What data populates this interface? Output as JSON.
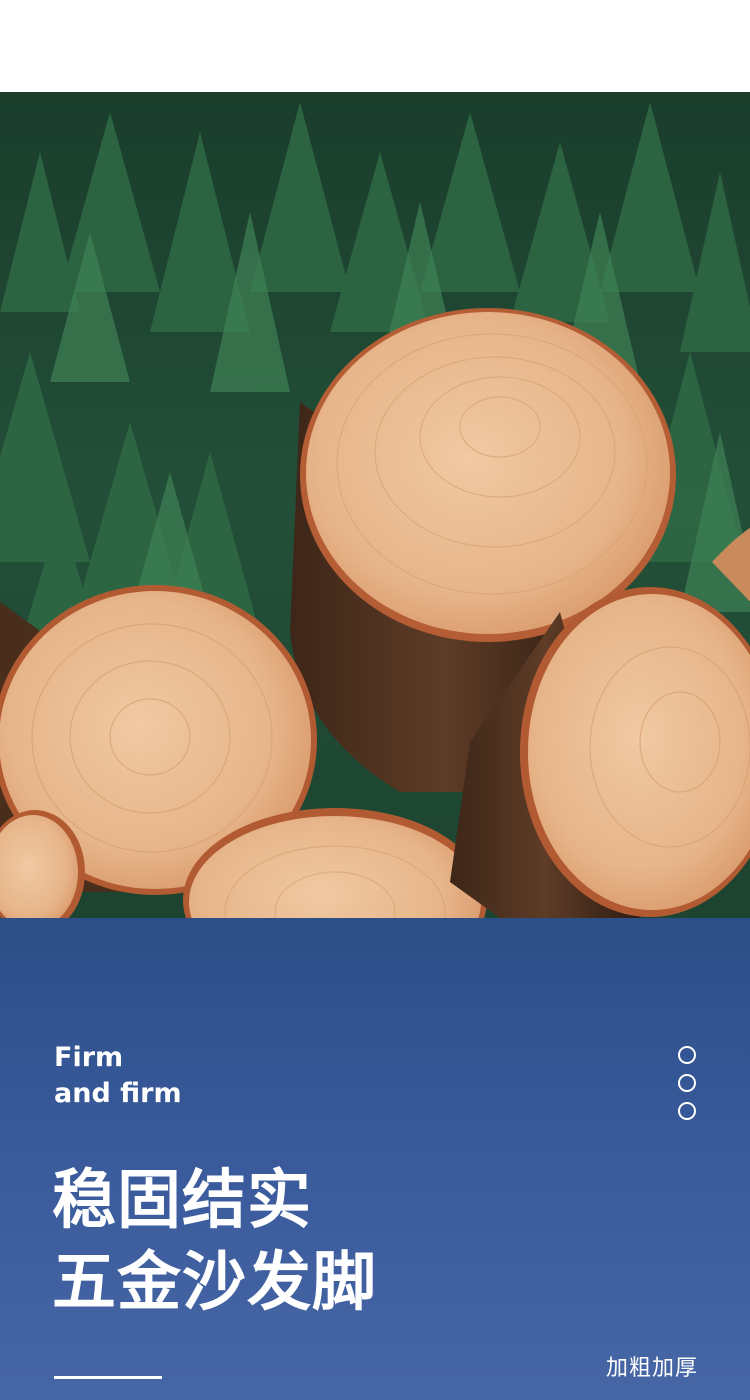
{
  "panel": {
    "english_line_1": "Firm",
    "english_line_2": "and firm",
    "headline_line_1": "稳固结实",
    "headline_line_2": "五金沙发脚",
    "tag": "加粗加厚"
  },
  "colors": {
    "panel_top": "#2d4f87",
    "panel_bottom": "#4766a6",
    "forest": "#1f4a35",
    "wood": "#e6b890",
    "bark": "#5b3a25"
  },
  "icons": {
    "dots": "three-hollow-circles"
  }
}
